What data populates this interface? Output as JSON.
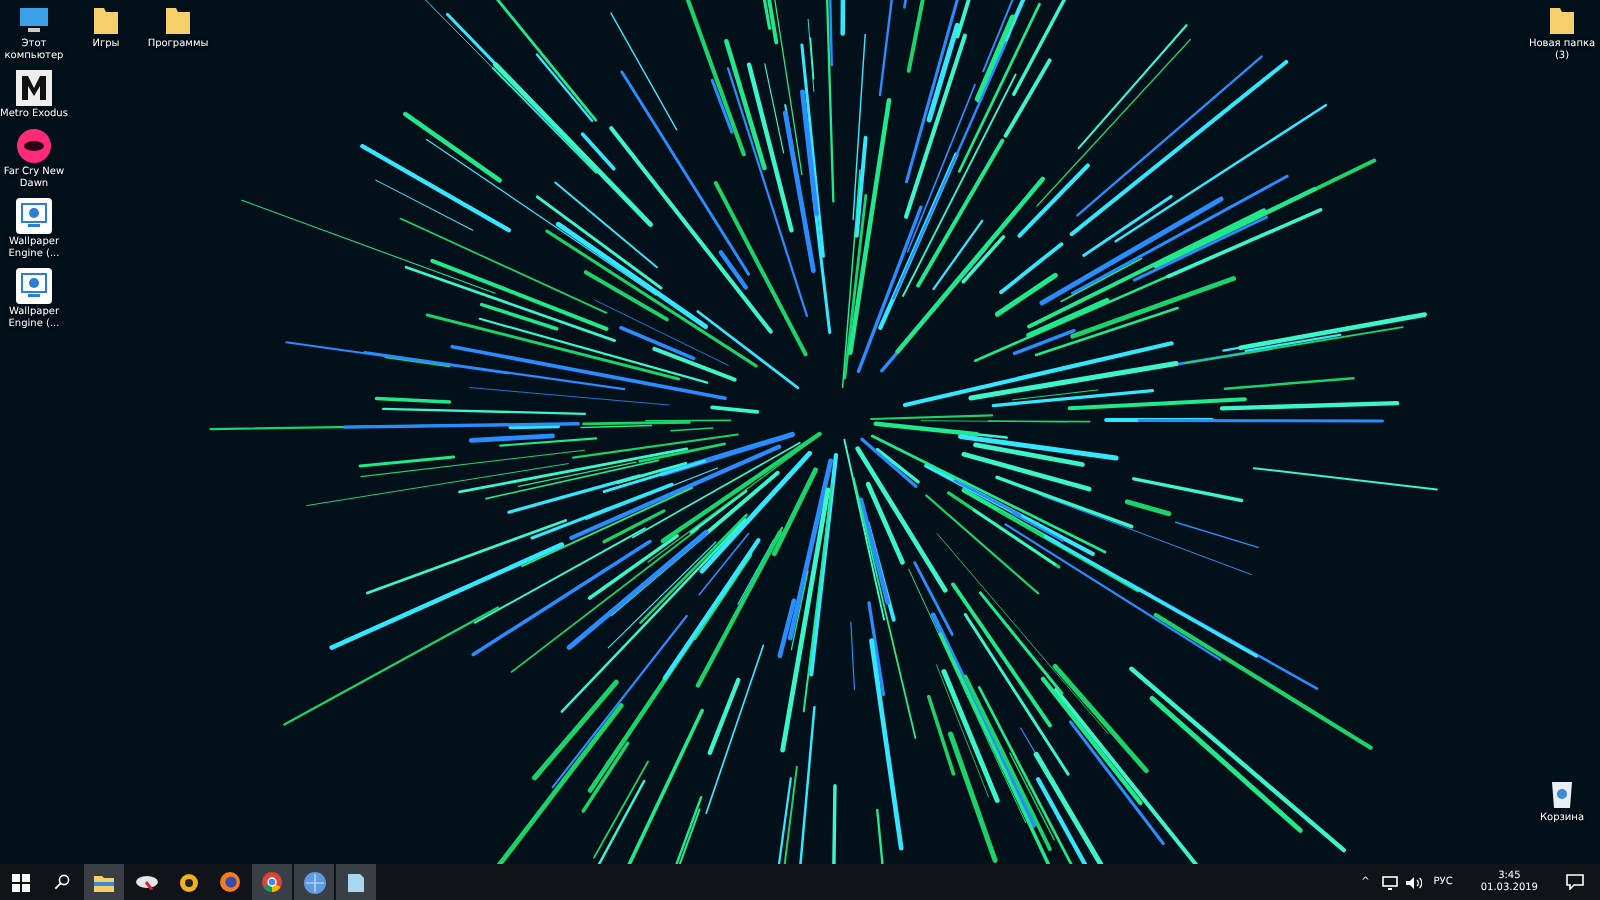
{
  "desktop": {
    "top_row": [
      {
        "label": "Этот компьютер",
        "kind": "computer"
      },
      {
        "label": "Игры",
        "kind": "folder"
      },
      {
        "label": "Программы",
        "kind": "folder"
      }
    ],
    "left_column": [
      {
        "label": "Metro Exodus",
        "kind": "metro"
      },
      {
        "label": "Far Cry New Dawn",
        "kind": "farcry"
      },
      {
        "label": "Wallpaper Engine (...",
        "kind": "wallpaper"
      },
      {
        "label": "Wallpaper Engine (...",
        "kind": "wallpaper"
      }
    ],
    "right_top": [
      {
        "label": "Новая папка (3)",
        "kind": "folder"
      }
    ],
    "right_bottom": [
      {
        "label": "Корзина",
        "kind": "recycle"
      }
    ]
  },
  "taskbar": {
    "apps": [
      {
        "kind": "explorer",
        "selected": true
      },
      {
        "kind": "disk",
        "selected": false
      },
      {
        "kind": "yellow",
        "selected": false
      },
      {
        "kind": "firefox",
        "selected": false
      },
      {
        "kind": "chrome",
        "selected": true
      },
      {
        "kind": "globe",
        "selected": true
      },
      {
        "kind": "notepad",
        "selected": true
      }
    ],
    "tray": {
      "chevron": "^",
      "language": "РУС",
      "time": "3:45",
      "date": "01.03.2019"
    }
  }
}
